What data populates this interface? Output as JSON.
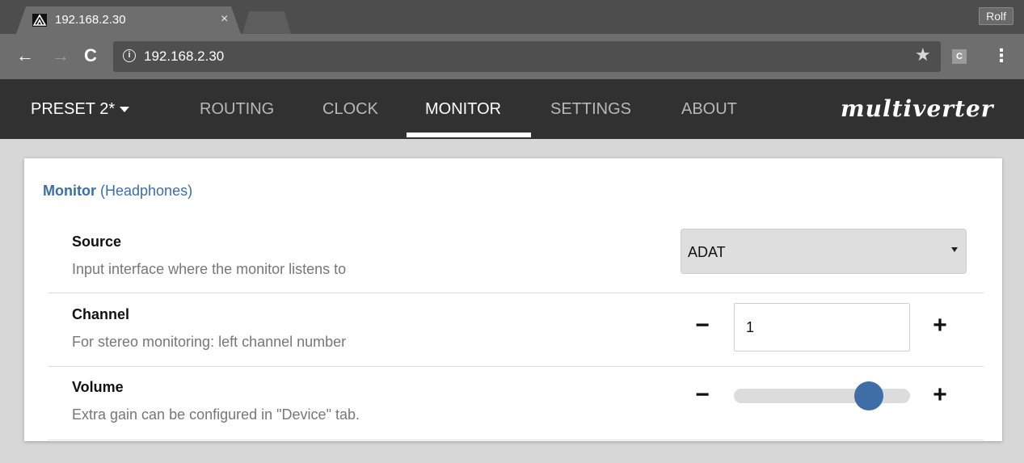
{
  "browser": {
    "tab_title": "192.168.2.30",
    "tab_close": "×",
    "profile": "Rolf",
    "url": "192.168.2.30",
    "info_glyph": "i",
    "ext_label": "C"
  },
  "navbar": {
    "preset_label": "PRESET 2*",
    "links": [
      "ROUTING",
      "CLOCK",
      "MONITOR",
      "SETTINGS",
      "ABOUT"
    ],
    "active": "MONITOR",
    "brand": "multiverter"
  },
  "panel": {
    "title_bold": "Monitor",
    "title_rest": "(Headphones)",
    "source": {
      "label": "Source",
      "description": "Input interface where the monitor listens to",
      "value": "ADAT"
    },
    "channel": {
      "label": "Channel",
      "description": "For stereo monitoring: left channel number",
      "value": "1",
      "minus": "−",
      "plus": "+"
    },
    "volume": {
      "label": "Volume",
      "description": "Extra gain can be configured in \"Device\" tab.",
      "level_fraction": 0.82,
      "minus": "−",
      "plus": "+"
    }
  },
  "colors": {
    "accent": "#3f6ea6",
    "navbar_bg": "#313131",
    "page_bg": "#d7d7d7"
  }
}
